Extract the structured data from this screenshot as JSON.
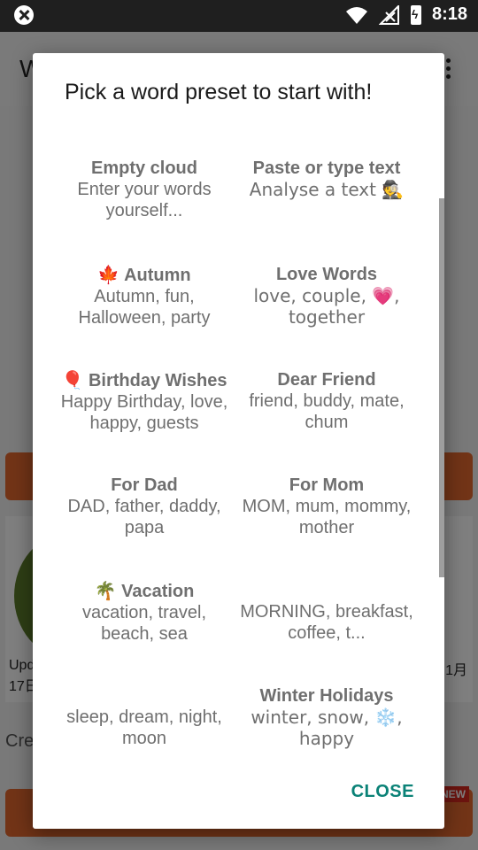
{
  "status_bar": {
    "time": "8:18"
  },
  "background": {
    "title": "W",
    "card_left_label": "Upd\n17日",
    "card_right_label": "1月",
    "create_text": "Cre",
    "new_badge": "NEW"
  },
  "dialog": {
    "title": "Pick a word preset to start with!",
    "close_label": "CLOSE",
    "presets": [
      {
        "icon": "",
        "name": "Empty cloud",
        "words": "Enter your words yourself..."
      },
      {
        "icon": "",
        "name": "Paste or type text",
        "words": "Analyse a text 🕵️"
      },
      {
        "icon": "🍁",
        "name": "Autumn",
        "words": "Autumn, fun, Halloween, party"
      },
      {
        "icon": "",
        "name": "Love Words",
        "words": "love, couple, 💗, together"
      },
      {
        "icon": "🎈",
        "name": "Birthday Wishes",
        "words": "Happy Birthday, love, happy, guests"
      },
      {
        "icon": "",
        "name": "Dear Friend",
        "words": "friend, buddy, mate, chum"
      },
      {
        "icon": "",
        "name": "For Dad",
        "words": "DAD, father, daddy, papa"
      },
      {
        "icon": "",
        "name": "For Mom",
        "words": "MOM, mum, mommy, mother"
      },
      {
        "icon": "🌴",
        "name": "Vacation",
        "words": "vacation, travel, beach, sea"
      },
      {
        "icon": "",
        "name": "",
        "words": "MORNING, breakfast, coffee, t..."
      },
      {
        "icon": "",
        "name": "",
        "words": "sleep, dream, night, moon"
      },
      {
        "icon": "",
        "name": "Winter Holidays",
        "words": "winter, snow, ❄️, happy"
      }
    ]
  }
}
